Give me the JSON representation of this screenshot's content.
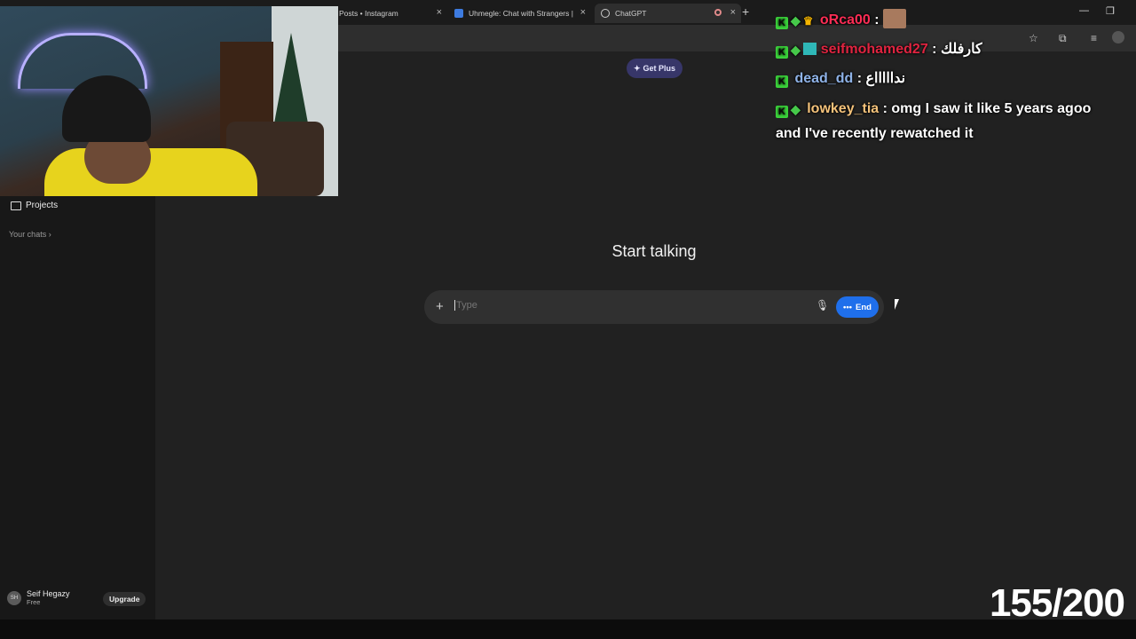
{
  "browser": {
    "tabs": [
      {
        "label": "Posts • Instagram",
        "active": false
      },
      {
        "label": "Uhmegle: Chat with Strangers |",
        "active": false
      },
      {
        "label": "ChatGPT",
        "active": true
      }
    ],
    "new_tab_glyph": "+",
    "close_glyph": "×"
  },
  "sidebar": {
    "projects_label": "Projects",
    "your_chats_label": "Your chats",
    "user_initials": "SH",
    "user_name": "Seif Hegazy",
    "user_plan": "Free",
    "upgrade_label": "Upgrade"
  },
  "main": {
    "get_plus_label": "Get Plus",
    "heading": "Start talking",
    "composer_placeholder": "Type",
    "end_label": "End",
    "accent_color": "#1f6feb"
  },
  "chat": {
    "messages": [
      {
        "user": "oRca00",
        "color": "#ff2d55",
        "badges": [
          "k",
          "diamond",
          "crown"
        ],
        "text": "",
        "emote": true
      },
      {
        "user": "seifmohamed27",
        "color": "#e02440",
        "badges": [
          "k",
          "diamond",
          "sub"
        ],
        "text": "كارفلك"
      },
      {
        "user": "dead_dd",
        "color": "#8fb3e8",
        "badges": [
          "k"
        ],
        "text": "نداااااع"
      },
      {
        "user": "lowkey_tia",
        "color": "#f4c27a",
        "badges": [
          "k",
          "diamond"
        ],
        "text": "omg I saw it like 5 years agoo",
        "text2": "and I've recently rewatched it"
      }
    ]
  },
  "counter": "155/200"
}
